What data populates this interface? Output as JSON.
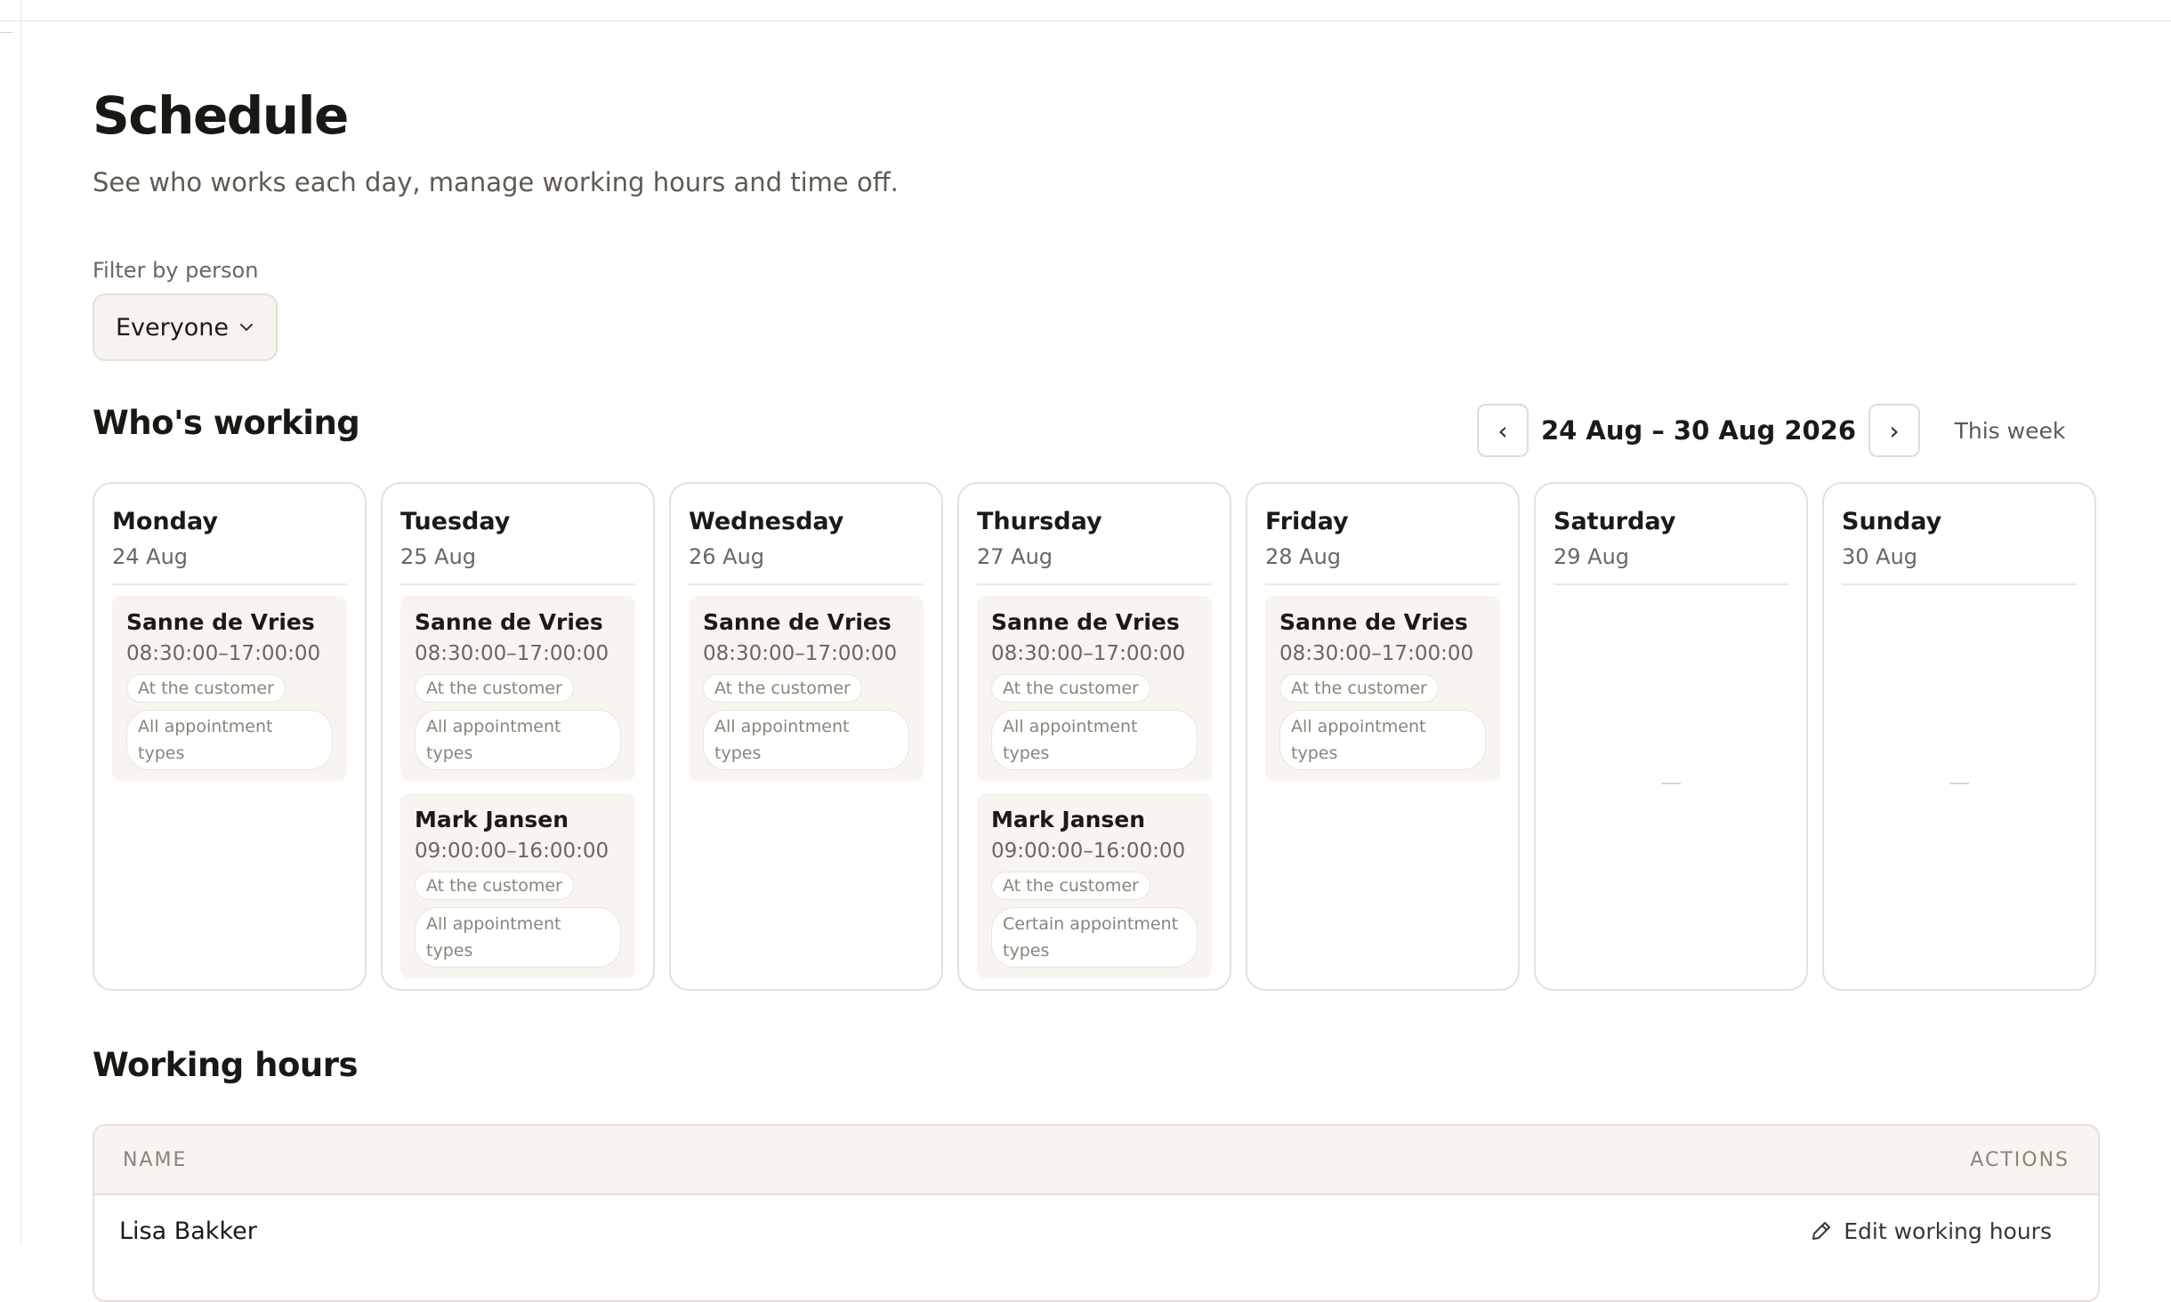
{
  "page": {
    "title": "Schedule",
    "subtitle": "See who works each day, manage working hours and time off."
  },
  "filter": {
    "label": "Filter by person",
    "selected": "Everyone"
  },
  "whos_working": {
    "title": "Who's working",
    "prev_icon": "‹",
    "next_icon": "›",
    "week_range": "24 Aug – 30 Aug 2026",
    "this_week_label": "This week",
    "days": [
      {
        "name": "Monday",
        "date": "24 Aug",
        "shifts": [
          {
            "person": "Sanne de Vries",
            "time": "08:30:00–17:00:00",
            "location": "At the customer",
            "types": "All appointment types"
          }
        ]
      },
      {
        "name": "Tuesday",
        "date": "25 Aug",
        "shifts": [
          {
            "person": "Sanne de Vries",
            "time": "08:30:00–17:00:00",
            "location": "At the customer",
            "types": "All appointment types"
          },
          {
            "person": "Mark Jansen",
            "time": "09:00:00–16:00:00",
            "location": "At the customer",
            "types": "All appointment types"
          }
        ]
      },
      {
        "name": "Wednesday",
        "date": "26 Aug",
        "shifts": [
          {
            "person": "Sanne de Vries",
            "time": "08:30:00–17:00:00",
            "location": "At the customer",
            "types": "All appointment types"
          }
        ]
      },
      {
        "name": "Thursday",
        "date": "27 Aug",
        "shifts": [
          {
            "person": "Sanne de Vries",
            "time": "08:30:00–17:00:00",
            "location": "At the customer",
            "types": "All appointment types"
          },
          {
            "person": "Mark Jansen",
            "time": "09:00:00–16:00:00",
            "location": "At the customer",
            "types": "Certain appointment types"
          }
        ]
      },
      {
        "name": "Friday",
        "date": "28 Aug",
        "shifts": [
          {
            "person": "Sanne de Vries",
            "time": "08:30:00–17:00:00",
            "location": "At the customer",
            "types": "All appointment types"
          }
        ]
      },
      {
        "name": "Saturday",
        "date": "29 Aug",
        "shifts": []
      },
      {
        "name": "Sunday",
        "date": "30 Aug",
        "shifts": []
      }
    ]
  },
  "working_hours": {
    "title": "Working hours",
    "columns": [
      "NAME",
      "ACTIONS"
    ],
    "rows": [
      {
        "name": "Lisa Bakker",
        "action_label": "Edit working hours"
      }
    ]
  },
  "icons": {
    "filter_chevron": "chevron-down-icon",
    "edit": "pencil-icon"
  }
}
